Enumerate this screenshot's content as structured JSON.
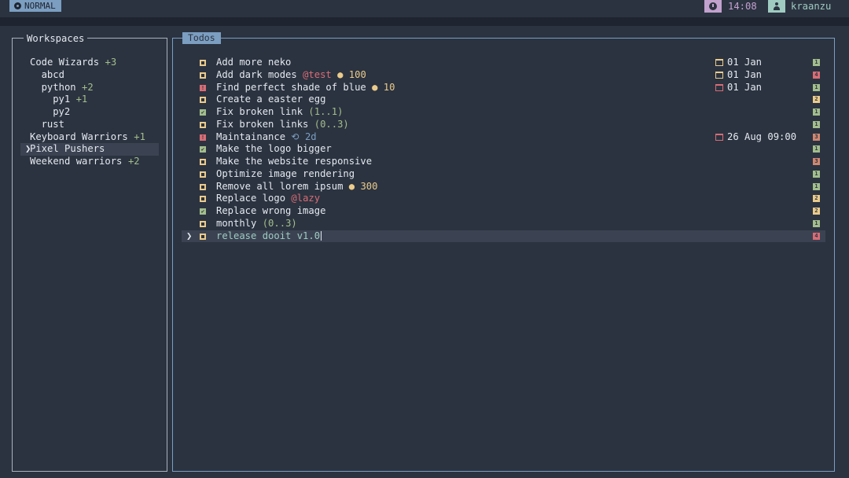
{
  "mode": "NORMAL",
  "clock": "14:08",
  "user": "kraanzu",
  "workspaces": {
    "title": "Workspaces",
    "items": [
      {
        "label": "Code Wizards",
        "count": "+3",
        "indent": 1
      },
      {
        "label": "abcd",
        "count": "",
        "indent": 2
      },
      {
        "label": "python",
        "count": "+2",
        "indent": 2
      },
      {
        "label": "py1",
        "count": "+1",
        "indent": 3
      },
      {
        "label": "py2",
        "count": "",
        "indent": 3
      },
      {
        "label": "rust",
        "count": "",
        "indent": 2
      },
      {
        "label": "Keyboard Warriors",
        "count": "+1",
        "indent": 1
      },
      {
        "label": "Pixel Pushers",
        "count": "",
        "indent": 1,
        "selected": true
      },
      {
        "label": "Weekend warriors",
        "count": "+2",
        "indent": 1
      }
    ]
  },
  "todos": {
    "title": "Todos",
    "items": [
      {
        "status": "pending",
        "text": "Add more neko",
        "tag": "",
        "effort": "",
        "progress": "",
        "recur": "",
        "due": "01 Jan",
        "due_kind": "future",
        "urgency": 1
      },
      {
        "status": "pending",
        "text": "Add dark modes",
        "tag": "@test",
        "effort": "100",
        "progress": "",
        "recur": "",
        "due": "01 Jan",
        "due_kind": "future",
        "urgency": 4
      },
      {
        "status": "overdue",
        "text": "Find perfect shade of blue",
        "tag": "",
        "effort": "10",
        "progress": "",
        "recur": "",
        "due": "01 Jan",
        "due_kind": "past",
        "urgency": 1
      },
      {
        "status": "pending",
        "text": "Create a easter egg",
        "tag": "",
        "effort": "",
        "progress": "",
        "recur": "",
        "due": "",
        "due_kind": "",
        "urgency": 2
      },
      {
        "status": "done",
        "text": "Fix broken link",
        "tag": "",
        "effort": "",
        "progress": "(1..1)",
        "recur": "",
        "due": "",
        "due_kind": "",
        "urgency": 1
      },
      {
        "status": "pending",
        "text": "Fix broken links",
        "tag": "",
        "effort": "",
        "progress": "(0..3)",
        "recur": "",
        "due": "",
        "due_kind": "",
        "urgency": 1
      },
      {
        "status": "overdue",
        "text": "Maintainance",
        "tag": "",
        "effort": "",
        "progress": "",
        "recur": "2d",
        "due": "26 Aug 09:00",
        "due_kind": "past",
        "urgency": 3
      },
      {
        "status": "done",
        "text": "Make the logo bigger",
        "tag": "",
        "effort": "",
        "progress": "",
        "recur": "",
        "due": "",
        "due_kind": "",
        "urgency": 1
      },
      {
        "status": "pending",
        "text": "Make the website responsive",
        "tag": "",
        "effort": "",
        "progress": "",
        "recur": "",
        "due": "",
        "due_kind": "",
        "urgency": 3
      },
      {
        "status": "pending",
        "text": "Optimize image rendering",
        "tag": "",
        "effort": "",
        "progress": "",
        "recur": "",
        "due": "",
        "due_kind": "",
        "urgency": 1
      },
      {
        "status": "pending",
        "text": "Remove all lorem ipsum",
        "tag": "",
        "effort": "300",
        "progress": "",
        "recur": "",
        "due": "",
        "due_kind": "",
        "urgency": 1
      },
      {
        "status": "pending",
        "text": "Replace logo",
        "tag": "@lazy",
        "effort": "",
        "progress": "",
        "recur": "",
        "due": "",
        "due_kind": "",
        "urgency": 2
      },
      {
        "status": "done",
        "text": "Replace wrong image",
        "tag": "",
        "effort": "",
        "progress": "",
        "recur": "",
        "due": "",
        "due_kind": "",
        "urgency": 2
      },
      {
        "status": "pending",
        "text": "monthly",
        "tag": "",
        "effort": "",
        "progress": "(0..3)",
        "recur": "",
        "due": "",
        "due_kind": "",
        "urgency": 1
      },
      {
        "status": "pending",
        "text": "release dooit v1.0",
        "tag": "",
        "effort": "",
        "progress": "",
        "recur": "",
        "due": "",
        "due_kind": "",
        "urgency": 4,
        "selected": true,
        "editing": true
      }
    ]
  },
  "colors": {
    "accent": "#7b9ec1",
    "background": "#2b3340",
    "tag": "#d96c75",
    "effort": "#ebcb8b",
    "count": "#a3be8c"
  }
}
